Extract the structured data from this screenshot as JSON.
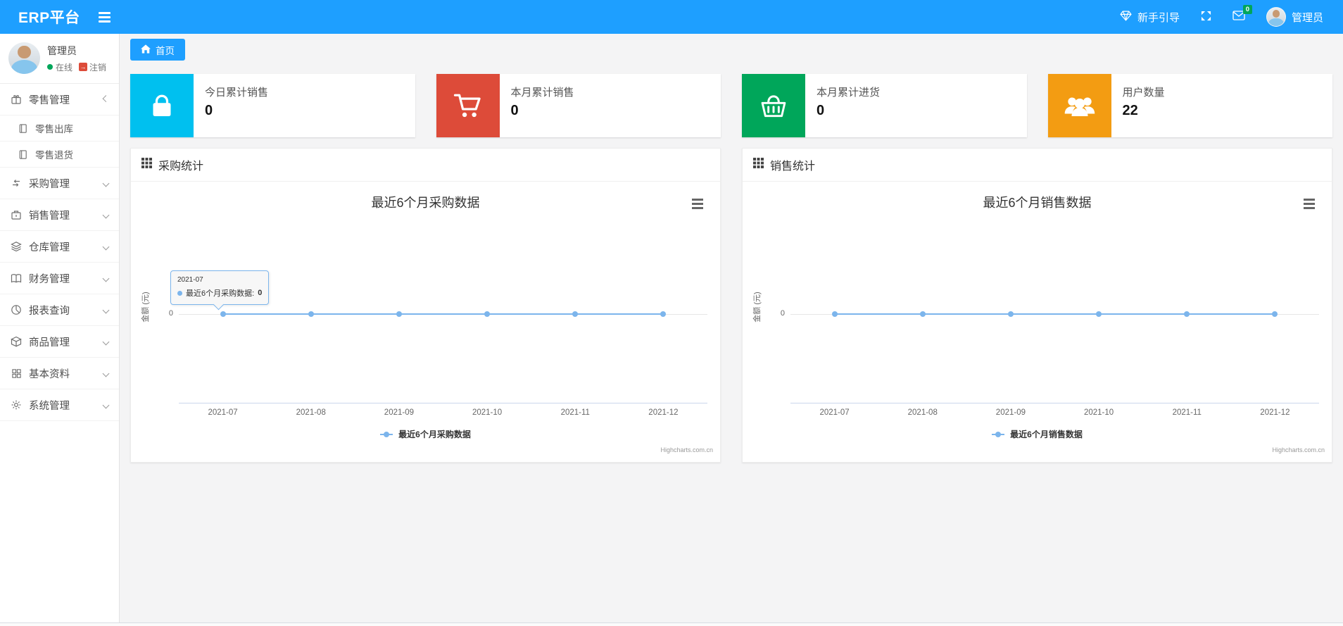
{
  "navbar": {
    "brand": "ERP平台",
    "guide_label": "新手引导",
    "messages_badge": "0",
    "user_name": "管理员",
    "icons": {
      "toggle": "hamburger-icon",
      "guide": "gem-icon",
      "fullscreen": "expand-arrows-icon",
      "messages": "envelope-icon"
    }
  },
  "sidebar": {
    "user_name": "管理员",
    "status_online": "在线",
    "logout_label": "注销",
    "items": [
      {
        "label": "零售管理",
        "icon": "gift-icon",
        "expanded": true,
        "children": [
          {
            "label": "零售出库",
            "icon": "journal-icon"
          },
          {
            "label": "零售退货",
            "icon": "journal-icon"
          }
        ]
      },
      {
        "label": "采购管理",
        "icon": "exchange-icon"
      },
      {
        "label": "销售管理",
        "icon": "briefcase-icon"
      },
      {
        "label": "仓库管理",
        "icon": "layers-icon"
      },
      {
        "label": "财务管理",
        "icon": "open-book-icon"
      },
      {
        "label": "报表查询",
        "icon": "pie-chart-icon"
      },
      {
        "label": "商品管理",
        "icon": "box-icon"
      },
      {
        "label": "基本资料",
        "icon": "grid-icon"
      },
      {
        "label": "系统管理",
        "icon": "gear-icon"
      }
    ]
  },
  "tabs": {
    "home": "首页"
  },
  "stat_cards": [
    {
      "label": "今日累计销售",
      "value": "0",
      "color": "#00c0ef",
      "icon": "shopping-bag-icon"
    },
    {
      "label": "本月累计销售",
      "value": "0",
      "color": "#dd4b39",
      "icon": "shopping-cart-icon"
    },
    {
      "label": "本月累计进货",
      "value": "0",
      "color": "#00a65a",
      "icon": "shopping-basket-icon"
    },
    {
      "label": "用户数量",
      "value": "22",
      "color": "#f39c12",
      "icon": "users-icon"
    }
  ],
  "panels": [
    {
      "title": "采购统计"
    },
    {
      "title": "销售统计"
    }
  ],
  "colors": {
    "navbar_blue": "#1e9fff",
    "badge_green": "#00a65a",
    "chart_line": "#7cb5ec"
  },
  "chart_data": [
    {
      "type": "line",
      "title": "最近6个月采购数据",
      "categories": [
        "2021-07",
        "2021-08",
        "2021-09",
        "2021-10",
        "2021-11",
        "2021-12"
      ],
      "series": [
        {
          "name": "最近6个月采购数据",
          "values": [
            0,
            0,
            0,
            0,
            0,
            0
          ]
        }
      ],
      "xlabel": "",
      "ylabel": "金额 (元)",
      "yticks": [
        "0"
      ],
      "ylim": [
        0,
        0
      ],
      "grid": false,
      "legend_position": "bottom",
      "line_color": "#7cb5ec",
      "credits": "Highcharts.com.cn",
      "tooltip": {
        "header": "2021-07",
        "label": "最近6个月采购数据:",
        "value": "0"
      }
    },
    {
      "type": "line",
      "title": "最近6个月销售数据",
      "categories": [
        "2021-07",
        "2021-08",
        "2021-09",
        "2021-10",
        "2021-11",
        "2021-12"
      ],
      "series": [
        {
          "name": "最近6个月销售数据",
          "values": [
            0,
            0,
            0,
            0,
            0,
            0
          ]
        }
      ],
      "xlabel": "",
      "ylabel": "金额 (元)",
      "yticks": [
        "0"
      ],
      "ylim": [
        0,
        0
      ],
      "grid": false,
      "legend_position": "bottom",
      "line_color": "#7cb5ec",
      "credits": "Highcharts.com.cn"
    }
  ]
}
